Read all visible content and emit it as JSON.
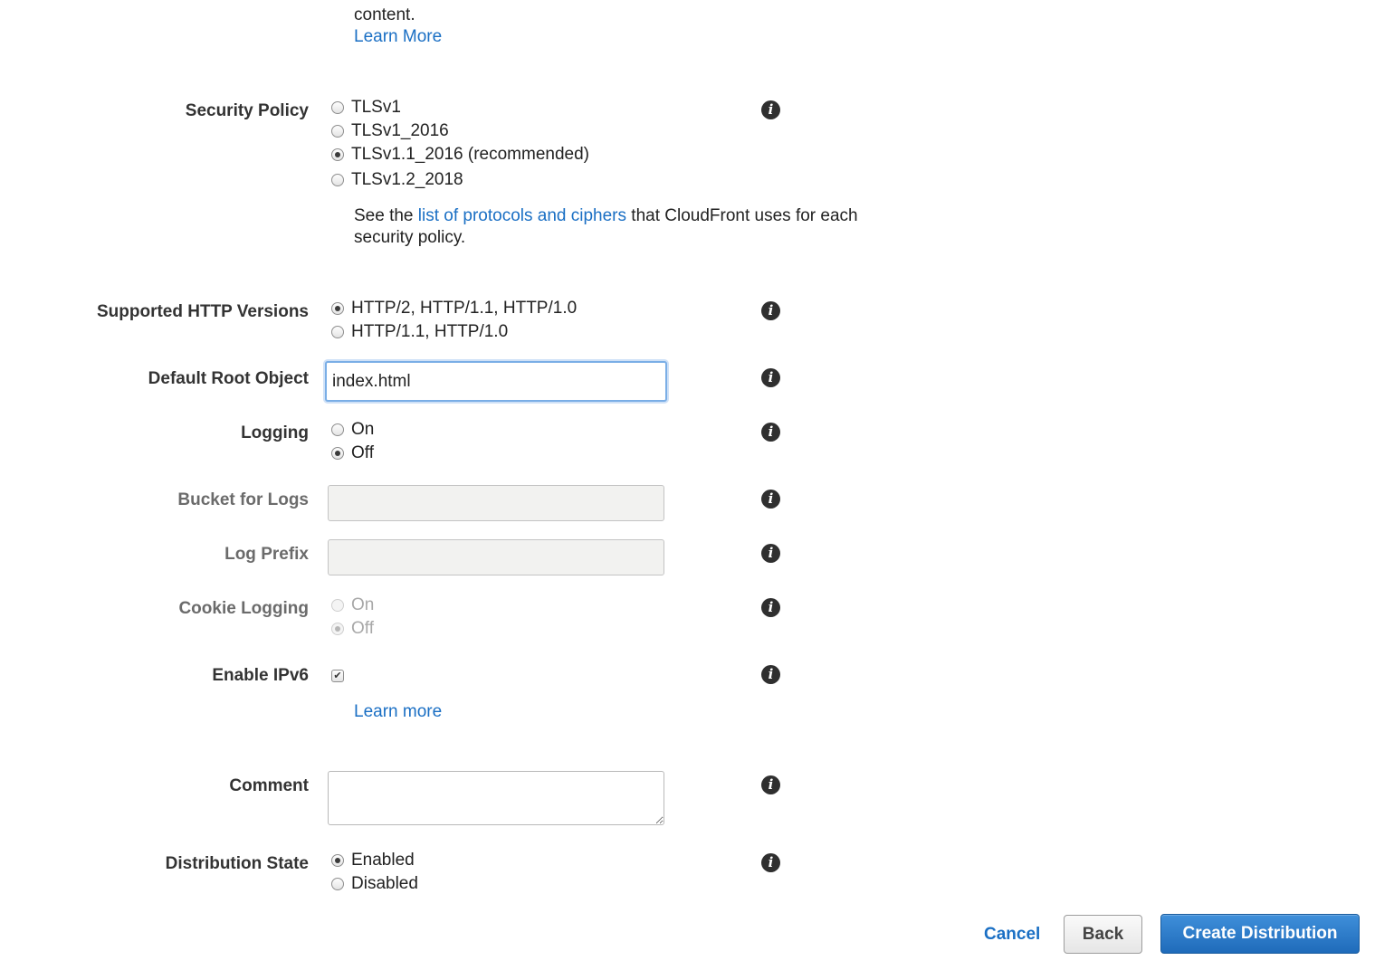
{
  "top_text": {
    "partial_line": "content.",
    "learn_more": "Learn More"
  },
  "security_policy": {
    "label": "Security Policy",
    "options": [
      "TLSv1",
      "TLSv1_2016",
      "TLSv1.1_2016 (recommended)",
      "TLSv1.2_2018"
    ],
    "selected": "TLSv1.1_2016 (recommended)",
    "note_before": "See the ",
    "note_link": "list of protocols and ciphers",
    "note_after": " that CloudFront uses for each",
    "note_line2": "security policy."
  },
  "http_versions": {
    "label": "Supported HTTP Versions",
    "options": [
      "HTTP/2, HTTP/1.1, HTTP/1.0",
      "HTTP/1.1, HTTP/1.0"
    ],
    "selected": "HTTP/2, HTTP/1.1, HTTP/1.0"
  },
  "default_root_object": {
    "label": "Default Root Object",
    "value": "index.html"
  },
  "logging": {
    "label": "Logging",
    "options": [
      "On",
      "Off"
    ],
    "selected": "Off"
  },
  "bucket_for_logs": {
    "label": "Bucket for Logs",
    "value": ""
  },
  "log_prefix": {
    "label": "Log Prefix",
    "value": ""
  },
  "cookie_logging": {
    "label": "Cookie Logging",
    "options": [
      "On",
      "Off"
    ],
    "selected": "Off"
  },
  "enable_ipv6": {
    "label": "Enable IPv6",
    "checked": true,
    "learn_more": "Learn more"
  },
  "comment": {
    "label": "Comment",
    "value": ""
  },
  "distribution_state": {
    "label": "Distribution State",
    "options": [
      "Enabled",
      "Disabled"
    ],
    "selected": "Enabled"
  },
  "actions": {
    "cancel": "Cancel",
    "back": "Back",
    "create": "Create Distribution"
  },
  "info_glyph": "i",
  "check_glyph": "✔",
  "colors": {
    "link": "#1a6fc4",
    "primary_button": "#2a7acb",
    "focus_ring": "#7aaee6"
  }
}
